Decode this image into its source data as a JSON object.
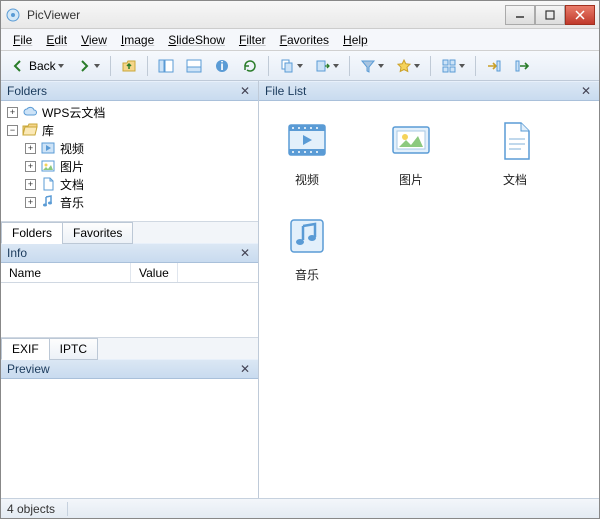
{
  "window": {
    "title": "PicViewer"
  },
  "menu": {
    "file": "File",
    "edit": "Edit",
    "view": "View",
    "image": "Image",
    "slideshow": "SlideShow",
    "filter": "Filter",
    "favorites": "Favorites",
    "help": "Help"
  },
  "toolbar": {
    "back_label": "Back"
  },
  "panels": {
    "folders_title": "Folders",
    "favorites_tab": "Favorites",
    "folders_tab": "Folders",
    "info_title": "Info",
    "info_name_col": "Name",
    "info_value_col": "Value",
    "exif_tab": "EXIF",
    "iptc_tab": "IPTC",
    "preview_title": "Preview",
    "filelist_title": "File List"
  },
  "tree": {
    "wps": "WPS云文档",
    "library": "库",
    "videos": "视频",
    "pictures": "图片",
    "documents": "文档",
    "music": "音乐"
  },
  "files": {
    "videos": "视频",
    "pictures": "图片",
    "documents": "文档",
    "music": "音乐"
  },
  "status": {
    "count": "4 objects"
  },
  "colors": {
    "accent": "#5a9bd5",
    "panel": "#d5e4f3"
  }
}
